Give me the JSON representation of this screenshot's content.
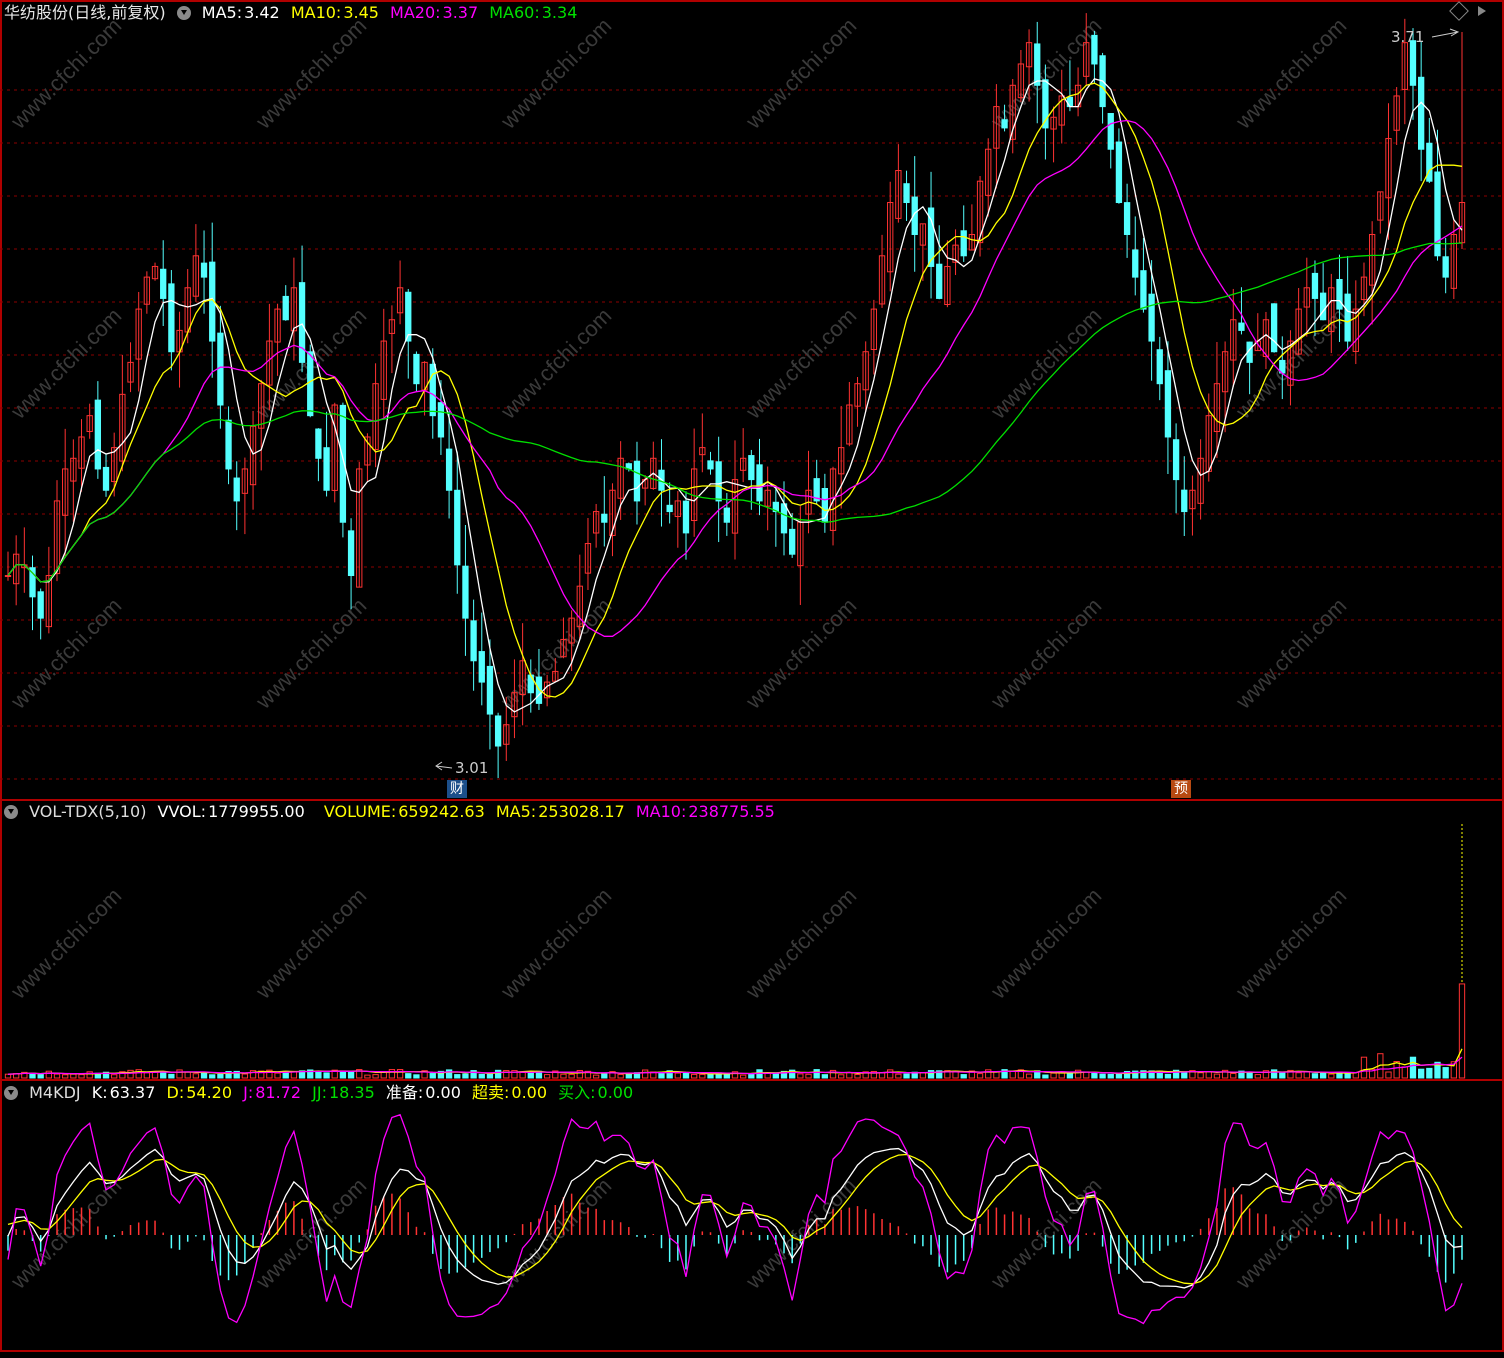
{
  "header": {
    "stock_name": "华纺股份(日线,前复权)",
    "ma5_label": "MA5:",
    "ma5_value": "3.42",
    "ma10_label": "MA10:",
    "ma10_value": "3.45",
    "ma20_label": "MA20:",
    "ma20_value": "3.37",
    "ma60_label": "MA60:",
    "ma60_value": "3.34"
  },
  "vol_panel": {
    "name": "VOL-TDX(5,10)",
    "vvol_label": "VVOL:",
    "vvol_value": "1779955.00",
    "volume_label": "VOLUME:",
    "volume_value": "659242.63",
    "ma5_label": "MA5:",
    "ma5_value": "253028.17",
    "ma10_label": "MA10:",
    "ma10_value": "238775.55"
  },
  "kdj_panel": {
    "name": "M4KDJ",
    "k_label": "K:",
    "k_value": "63.37",
    "d_label": "D:",
    "d_value": "54.20",
    "j_label": "J:",
    "j_value": "81.72",
    "jj_label": "JJ:",
    "jj_value": "18.35",
    "prep_label": "准备:",
    "prep_value": "0.00",
    "oversold_label": "超卖:",
    "oversold_value": "0.00",
    "buy_label": "买入:",
    "buy_value": "0.00"
  },
  "markers": {
    "high_label": "3.71",
    "low_label": "3.01",
    "cai_tag": "财",
    "yu_tag": "预"
  },
  "watermark_text": "www.cfchi.com",
  "colors": {
    "up": "#ff3232",
    "down": "#54ffff",
    "ma5": "#ffffff",
    "ma10": "#ffff00",
    "ma20": "#ff00ff",
    "ma60": "#00e000",
    "grid": "#8b0000",
    "border": "#b00000"
  },
  "chart_data": {
    "type": "candlestick",
    "price_range": [
      3.01,
      3.71
    ],
    "candles_close": [
      3.2,
      3.22,
      3.21,
      3.18,
      3.16,
      3.2,
      3.27,
      3.3,
      3.31,
      3.33,
      3.35,
      3.3,
      3.28,
      3.32,
      3.37,
      3.4,
      3.45,
      3.48,
      3.49,
      3.46,
      3.41,
      3.43,
      3.47,
      3.5,
      3.48,
      3.42,
      3.36,
      3.3,
      3.27,
      3.3,
      3.34,
      3.38,
      3.42,
      3.45,
      3.44,
      3.47,
      3.4,
      3.35,
      3.31,
      3.28,
      3.36,
      3.25,
      3.2,
      3.3,
      3.33,
      3.38,
      3.42,
      3.44,
      3.47,
      3.42,
      3.38,
      3.4,
      3.35,
      3.33,
      3.28,
      3.21,
      3.16,
      3.12,
      3.1,
      3.07,
      3.04,
      3.06,
      3.09,
      3.12,
      3.09,
      3.08,
      3.1,
      3.11,
      3.14,
      3.16,
      3.19,
      3.23,
      3.26,
      3.25,
      3.28,
      3.31,
      3.3,
      3.27,
      3.29,
      3.31,
      3.28,
      3.26,
      3.27,
      3.24,
      3.3,
      3.32,
      3.3,
      3.27,
      3.25,
      3.29,
      3.31,
      3.29,
      3.27,
      3.28,
      3.26,
      3.24,
      3.22,
      3.25,
      3.28,
      3.27,
      3.25,
      3.3,
      3.32,
      3.36,
      3.38,
      3.41,
      3.45,
      3.5,
      3.55,
      3.58,
      3.55,
      3.52,
      3.53,
      3.49,
      3.46,
      3.49,
      3.51,
      3.5,
      3.52,
      3.57,
      3.6,
      3.64,
      3.62,
      3.66,
      3.68,
      3.7,
      3.66,
      3.62,
      3.63,
      3.65,
      3.64,
      3.66,
      3.7,
      3.68,
      3.64,
      3.6,
      3.55,
      3.52,
      3.48,
      3.45,
      3.42,
      3.38,
      3.33,
      3.29,
      3.26,
      3.28,
      3.31,
      3.35,
      3.38,
      3.41,
      3.44,
      3.43,
      3.4,
      3.42,
      3.44,
      3.41,
      3.39,
      3.42,
      3.45,
      3.47,
      3.46,
      3.44,
      3.47,
      3.45,
      3.42,
      3.45,
      3.48,
      3.52,
      3.56,
      3.61,
      3.65,
      3.7,
      3.66,
      3.6,
      3.57,
      3.5,
      3.48,
      3.52,
      3.55
    ]
  }
}
